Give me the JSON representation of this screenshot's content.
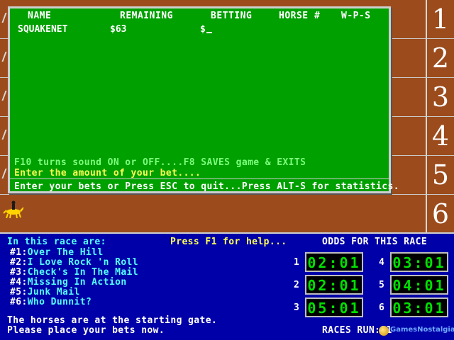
{
  "track": {
    "post_numbers": [
      "1",
      "2",
      "3",
      "4",
      "5",
      "6"
    ],
    "colors": {
      "dirt": "#9c4c1c",
      "rail": "#d8d8d8"
    }
  },
  "bet_window": {
    "headers": {
      "name": "NAME",
      "remaining": "REMAINING",
      "betting": "BETTING",
      "horse": "HORSE #",
      "wps": "W-P-S"
    },
    "row": {
      "name": "SQUAKENET",
      "remaining": "$63",
      "betting": "$"
    },
    "msg_sound": "F10 turns sound ON or OFF....F8 SAVES game & EXITS",
    "msg_amount": "Enter the amount of your bet....",
    "msg_bottom": "Enter your bets or Press ESC to quit...Press ALT-S for statistics.",
    "colors": {
      "background": "#00a000"
    }
  },
  "info": {
    "race_intro": "In this race are:",
    "help": "Press F1 for help...",
    "odds_title": "ODDS FOR THIS RACE",
    "horses": [
      {
        "num": "#1:",
        "name": "Over The Hill"
      },
      {
        "num": "#2:",
        "name": "I Love Rock 'n Roll"
      },
      {
        "num": "#3:",
        "name": "Check's In The Mail"
      },
      {
        "num": "#4:",
        "name": "Missing In Action"
      },
      {
        "num": "#5:",
        "name": "Junk Mail"
      },
      {
        "num": "#6:",
        "name": "Who Dunnit?"
      }
    ],
    "odds": [
      {
        "label": "1",
        "value": "02:01"
      },
      {
        "label": "2",
        "value": "02:01"
      },
      {
        "label": "3",
        "value": "05:01"
      },
      {
        "label": "4",
        "value": "03:01"
      },
      {
        "label": "5",
        "value": "04:01"
      },
      {
        "label": "6",
        "value": "03:01"
      }
    ],
    "status_1": "The horses are at the starting gate.",
    "status_2": "Please place your bets now.",
    "races_run": "RACES RUN:11",
    "colors": {
      "panel": "#0000a8",
      "odds_digits": "#00e000"
    }
  },
  "watermark": "GamesNostalgia.com",
  "icons": {
    "jockey": "jockey-on-horse-icon",
    "lane_marker": "lane-pole-icon"
  }
}
